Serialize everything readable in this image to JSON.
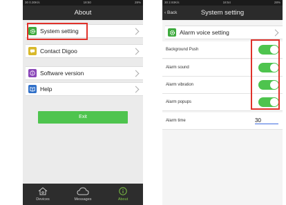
{
  "left": {
    "status": {
      "left": "30 0.30K/s",
      "center": "18:50",
      "right": "28%"
    },
    "title": "About",
    "items": [
      {
        "label": "System setting"
      },
      {
        "label": "Contact Digoo"
      },
      {
        "label": "Software version"
      },
      {
        "label": "Help"
      }
    ],
    "exit_label": "Exit",
    "tabs": [
      {
        "label": "Devices"
      },
      {
        "label": "Messages"
      },
      {
        "label": "About"
      }
    ]
  },
  "right": {
    "status": {
      "left": "30 2.93K/s",
      "center": "18:54",
      "right": "28%"
    },
    "back_label": "Back",
    "title": "System setting",
    "voice_label": "Alarm voice setting",
    "settings": [
      {
        "label": "Background Push",
        "on": true
      },
      {
        "label": "Alarm sound",
        "on": true
      },
      {
        "label": "Alarm vibration",
        "on": true
      },
      {
        "label": "Alarm popups",
        "on": true
      }
    ],
    "alarm_time_label": "Alarm time",
    "alarm_time_value": "30"
  },
  "colors": {
    "accent": "#4ec44e",
    "highlight": "#e0312a",
    "header": "#2b2b2b",
    "active_tab": "#7ec445"
  }
}
